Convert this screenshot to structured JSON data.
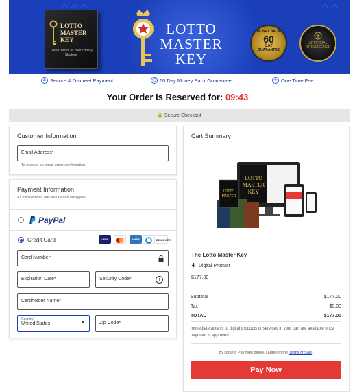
{
  "banner": {
    "book_title_1": "LOTTO",
    "book_title_2": "MASTER",
    "book_title_3": "KEY",
    "book_subtitle": "Take Control of Your Lottery Strategy",
    "logo_line1": "LOTTO",
    "logo_line2": "MASTER",
    "logo_line3": "KEY",
    "seal1_top": "MONEY BACK",
    "seal1_big": "60",
    "seal1_mid": "DAY",
    "seal1_bottom": "GUARANTEE",
    "seal2_text": "ARTIFICIAL INTELLIGENCE"
  },
  "trust": {
    "item1": "Secure & Discreet Payment",
    "item2": "60 Day Money Back Guarantee",
    "item3": "One Time Fee"
  },
  "reserve": {
    "label": "Your Order Is Reserved for:",
    "timer": "09:43"
  },
  "secure_bar": "Secure Checkout",
  "customer": {
    "heading": "Customer Information",
    "email_placeholder": "Email Address*",
    "email_hint": "To receive an email order confirmation."
  },
  "payment": {
    "heading": "Payment Information",
    "subheading": "All transactions are secure and encrypted.",
    "paypal_label": "PayPal",
    "credit_label": "Credit Card",
    "card_number": "Card Number*",
    "expiration": "Expiration Date*",
    "security_code": "Security Code*",
    "cardholder": "Cardholder Name*",
    "country_label": "Country*",
    "country_value": "United States",
    "zip": "Zip Code*",
    "card_brands": [
      "VISA",
      "MC",
      "AMEX",
      "DISCOVER"
    ]
  },
  "cart": {
    "heading": "Cart Summary",
    "product_name": "The Lotto Master Key",
    "product_type": "Digital Product",
    "product_price": "$177.00",
    "subtotal_label": "Subtotal",
    "subtotal_value": "$177.00",
    "tax_label": "Tax",
    "tax_value": "$0.00",
    "total_label": "TOTAL",
    "total_value": "$177.00",
    "note": "Immediate access to digital products or services in your cart are available once payment is approved.",
    "terms_prefix": "By clicking Pay Now below, I agree to the",
    "terms_link": "Terms of Sale",
    "terms_suffix": ".",
    "pay_button": "Pay Now"
  },
  "colors": {
    "brand_blue": "#1a3fb8",
    "accent_red": "#e53935",
    "paypal_dark": "#253b80",
    "paypal_light": "#179bd7"
  }
}
